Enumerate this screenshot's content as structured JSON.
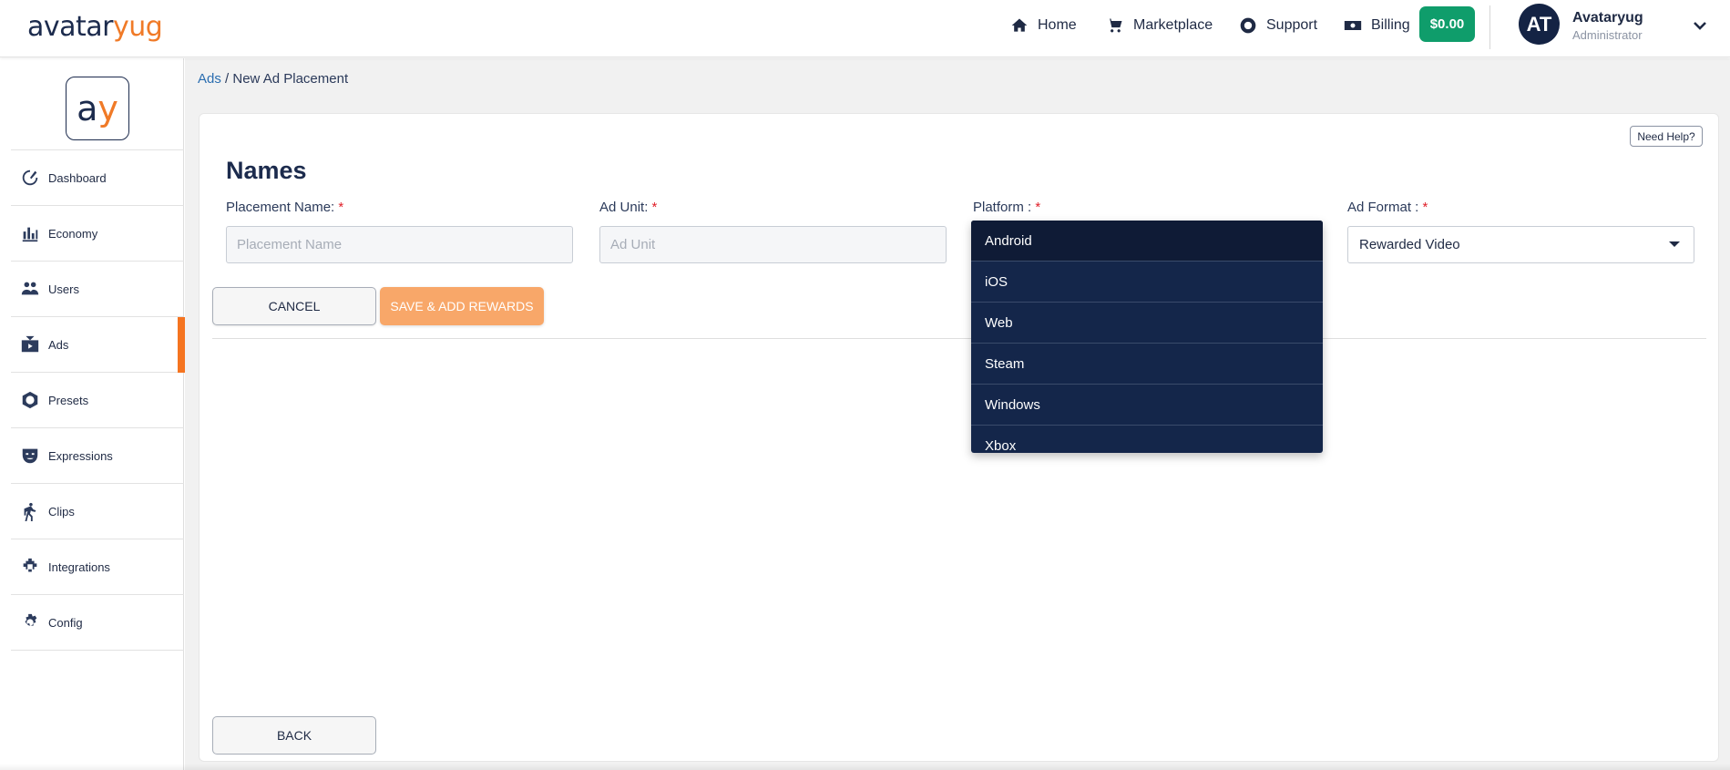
{
  "brand": {
    "part1": "avatar",
    "part2": "yug",
    "mini_part1": "a",
    "mini_part2": "y"
  },
  "topnav": {
    "items": [
      {
        "label": "Home",
        "icon": "home-icon"
      },
      {
        "label": "Marketplace",
        "icon": "cart-icon"
      },
      {
        "label": "Support",
        "icon": "lifebuoy-icon"
      },
      {
        "label": "Billing",
        "icon": "money-icon"
      }
    ],
    "balance": "$0.00",
    "user": {
      "initials": "AT",
      "name": "Avataryug",
      "role": "Administrator"
    }
  },
  "sidebar": {
    "items": [
      {
        "label": "Dashboard",
        "icon": "dashboard-icon",
        "active": false
      },
      {
        "label": "Economy",
        "icon": "chart-icon",
        "active": false
      },
      {
        "label": "Users",
        "icon": "users-icon",
        "active": false
      },
      {
        "label": "Ads",
        "icon": "ads-icon",
        "active": true
      },
      {
        "label": "Presets",
        "icon": "presets-icon",
        "active": false
      },
      {
        "label": "Expressions",
        "icon": "mask-icon",
        "active": false
      },
      {
        "label": "Clips",
        "icon": "walk-icon",
        "active": false
      },
      {
        "label": "Integrations",
        "icon": "puzzle-icon",
        "active": false
      },
      {
        "label": "Config",
        "icon": "gear-icon",
        "active": false
      }
    ]
  },
  "breadcrumb": {
    "parent": "Ads",
    "separator": " / ",
    "current": "New Ad Placement"
  },
  "form": {
    "help_label": "Need Help?",
    "section_title": "Names",
    "placement_name": {
      "label": "Placement Name:",
      "placeholder": "Placement Name",
      "value": ""
    },
    "ad_unit": {
      "label": "Ad Unit:",
      "placeholder": "Ad Unit",
      "value": ""
    },
    "platform": {
      "label": "Platform :",
      "options": [
        "Android",
        "iOS",
        "Web",
        "Steam",
        "Windows",
        "Xbox"
      ],
      "highlighted": "Android"
    },
    "ad_format": {
      "label": "Ad Format :",
      "value": "Rewarded Video"
    },
    "required_mark": "*",
    "cancel_label": "CANCEL",
    "save_label": "SAVE & ADD REWARDS",
    "back_label": "BACK"
  },
  "colors": {
    "accent": "#f57420",
    "navy": "#14264a",
    "success": "#0f9d6b",
    "save_button": "#f8a769"
  }
}
